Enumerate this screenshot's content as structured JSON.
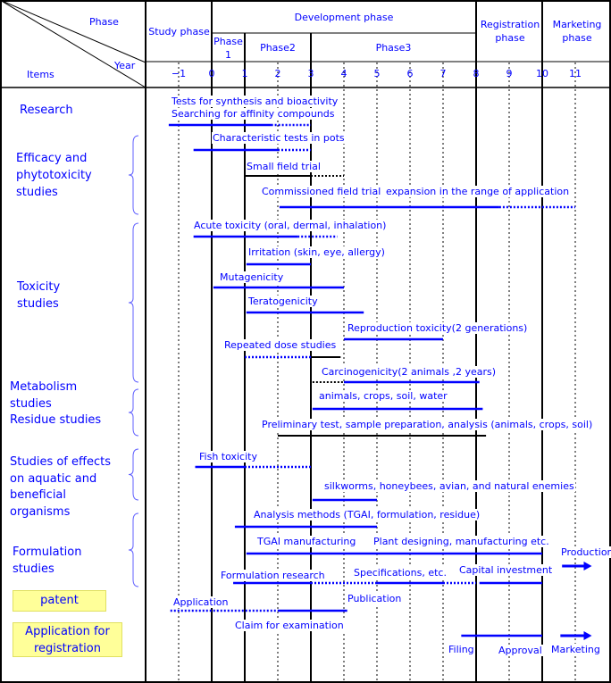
{
  "header": {
    "phase_label": "Phase",
    "year_label": "Year",
    "items_label": "Items",
    "study_phase": "Study phase",
    "development_phase": "Development phase",
    "phase1": "Phase 1",
    "phase2": "Phase2",
    "phase3": "Phase3",
    "registration_phase": "Registration phase",
    "marketing_phase": "Marketing phase"
  },
  "years": [
    -1,
    0,
    1,
    2,
    3,
    4,
    5,
    6,
    7,
    8,
    9,
    10,
    11
  ],
  "items": {
    "research": "Research",
    "efficacy": "Efficacy and phytotoxicity studies",
    "toxicity": "Toxicity studies",
    "metabolism": "Metabolism studies",
    "residue": "Residue studies",
    "aquatic": "Studies of effects on aquatic and beneficial organisms",
    "formulation": "Formulation studies",
    "patent": "patent",
    "registration": "Application for registration"
  },
  "labels": {
    "research1": "Tests for synthesis and bioactivity",
    "research2": "Searching for affinity compounds",
    "pots": "Characteristic tests in pots",
    "small_field": "Small field trial",
    "commissioned": "Commissioned field trial",
    "expansion": "expansion in the range of application",
    "acute": "Acute toxicity (oral, dermal, inhalation)",
    "irritation": "Irritation (skin, eye, allergy)",
    "mutagenicity": "Mutagenicity",
    "teratogenicity": "Teratogenicity",
    "reproduction": "Reproduction toxicity(2 generations)",
    "repeated": "Repeated dose studies",
    "carcinogenicity": "Carcinogenicity(2 animals ,2 years)",
    "metab": "animals, crops, soil, water",
    "preliminary": "Preliminary  test, sample preparation, analysis (animals, crops, soil)",
    "fish": "Fish toxicity",
    "silkworms": "silkworms, honeybees, avian, and natural enemies",
    "analysis": "Analysis methods (TGAI, formulation, residue)",
    "tgai": "TGAI manufacturing",
    "plant": "Plant designing, manufacturing etc.",
    "production": "Production",
    "formulation_research": "Formulation research",
    "specifications": "Specifications, etc.",
    "capital": "Capital investment",
    "application": "Application",
    "publication": "Publication",
    "claim": "Claim for examination",
    "filing": "Filing",
    "approval": "Approval",
    "marketing": "Marketing"
  },
  "colors": {
    "bar": "#0000ff",
    "text": "#0000ff",
    "box": "#ffff99",
    "line": "#000000"
  },
  "bars": [
    {
      "name": "research",
      "segments": [
        [
          -1.3,
          1.8,
          "blue"
        ],
        [
          1.8,
          3,
          "blue-dot"
        ]
      ]
    },
    {
      "name": "pots",
      "segments": [
        [
          -0.55,
          2,
          "blue"
        ],
        [
          2,
          3,
          "blue-dot"
        ]
      ]
    },
    {
      "name": "small-field",
      "segments": [
        [
          1,
          3,
          "black"
        ],
        [
          3,
          4,
          "black-dot"
        ]
      ]
    },
    {
      "name": "commissioned",
      "segments": [
        [
          2.05,
          8.7,
          "blue"
        ],
        [
          8.7,
          11,
          "blue-dot"
        ]
      ]
    },
    {
      "name": "acute",
      "segments": [
        [
          -0.55,
          2.6,
          "blue"
        ],
        [
          2.6,
          3.8,
          "blue-dot"
        ]
      ]
    },
    {
      "name": "irritation",
      "segments": [
        [
          1.05,
          3,
          "blue"
        ]
      ]
    },
    {
      "name": "mutagenicity",
      "segments": [
        [
          0.05,
          4,
          "blue"
        ]
      ]
    },
    {
      "name": "teratogenicity",
      "segments": [
        [
          1.05,
          4.6,
          "blue"
        ]
      ]
    },
    {
      "name": "reproduction",
      "segments": [
        [
          4,
          7,
          "blue"
        ]
      ]
    },
    {
      "name": "repeated",
      "segments": [
        [
          1,
          3,
          "blue-dot"
        ],
        [
          3,
          3.9,
          "black"
        ]
      ]
    },
    {
      "name": "carcinogenicity",
      "segments": [
        [
          3.05,
          4,
          "black-dot"
        ],
        [
          4,
          8.1,
          "blue"
        ]
      ]
    },
    {
      "name": "metab",
      "segments": [
        [
          3.05,
          8.2,
          "blue"
        ]
      ]
    },
    {
      "name": "preliminary",
      "segments": [
        [
          2,
          8.3,
          "black"
        ]
      ]
    },
    {
      "name": "fish",
      "segments": [
        [
          -0.5,
          1,
          "blue"
        ],
        [
          1,
          3,
          "blue-dot"
        ]
      ]
    },
    {
      "name": "silkworms",
      "segments": [
        [
          3.05,
          5,
          "blue"
        ]
      ]
    },
    {
      "name": "analysis",
      "segments": [
        [
          0.7,
          5,
          "blue"
        ]
      ]
    },
    {
      "name": "tgai",
      "segments": [
        [
          1.05,
          10,
          "blue"
        ]
      ]
    },
    {
      "name": "production",
      "segments": [
        [
          10.6,
          11.5,
          "arrow"
        ]
      ]
    },
    {
      "name": "formulation",
      "segments": [
        [
          0.65,
          3,
          "blue"
        ],
        [
          3,
          5,
          "blue-dot"
        ],
        [
          5,
          7,
          "blue"
        ],
        [
          7,
          8,
          "blue-dot"
        ],
        [
          8.1,
          10,
          "blue"
        ]
      ]
    },
    {
      "name": "application",
      "segments": [
        [
          -1.25,
          2,
          "blue-dot"
        ],
        [
          2,
          4.1,
          "blue"
        ]
      ]
    },
    {
      "name": "filing",
      "segments": [
        [
          7.55,
          10,
          "blue"
        ]
      ]
    },
    {
      "name": "marketing",
      "segments": [
        [
          10.55,
          11.5,
          "arrow"
        ]
      ]
    }
  ]
}
